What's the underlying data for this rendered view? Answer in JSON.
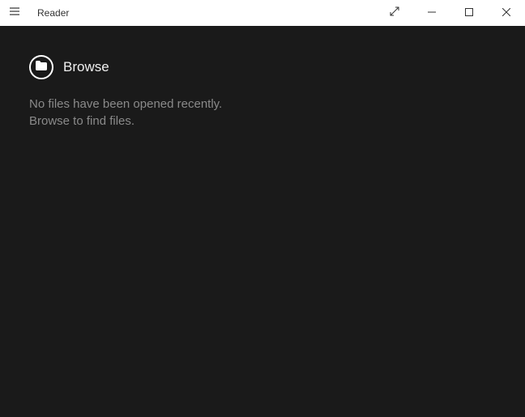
{
  "titlebar": {
    "app_title": "Reader"
  },
  "main": {
    "browse_label": "Browse",
    "empty_line1": "No files have been opened recently.",
    "empty_line2": "Browse to find files."
  }
}
